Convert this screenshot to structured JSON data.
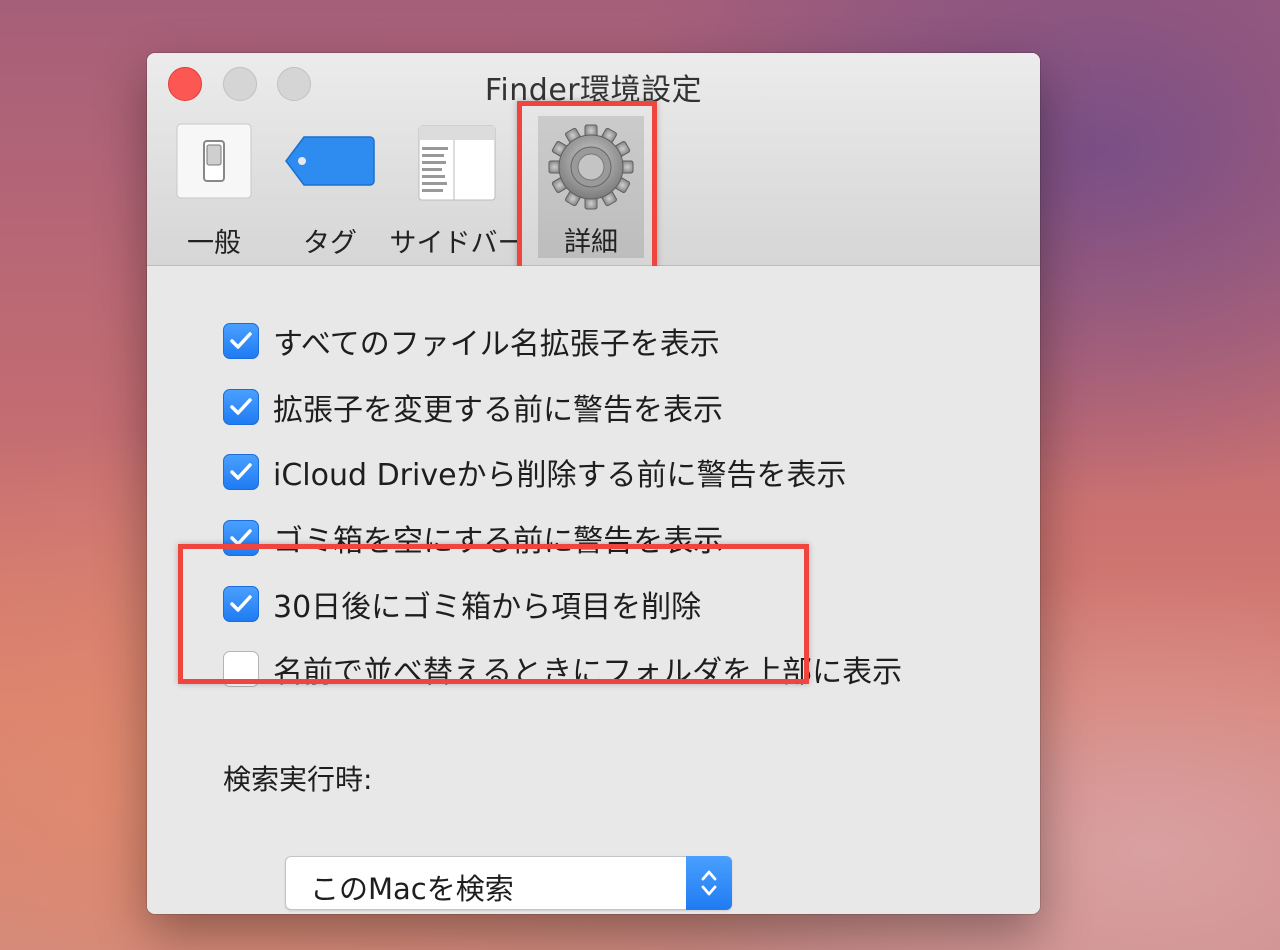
{
  "window": {
    "title": "Finder環境設定"
  },
  "toolbar": {
    "tabs": [
      {
        "label": "一般",
        "icon": "switch-icon"
      },
      {
        "label": "タグ",
        "icon": "tag-icon"
      },
      {
        "label": "サイドバー",
        "icon": "sidebar-icon"
      },
      {
        "label": "詳細",
        "icon": "gear-icon",
        "selected": true
      }
    ]
  },
  "options": [
    {
      "label": "すべてのファイル名拡張子を表示",
      "checked": true
    },
    {
      "label": "拡張子を変更する前に警告を表示",
      "checked": true
    },
    {
      "label": "iCloud Driveから削除する前に警告を表示",
      "checked": true
    },
    {
      "label": "ゴミ箱を空にする前に警告を表示",
      "checked": true
    },
    {
      "label": "30日後にゴミ箱から項目を削除",
      "checked": true
    },
    {
      "label": "名前で並べ替えるときにフォルダを上部に表示",
      "checked": false
    }
  ],
  "search": {
    "label": "検索実行時:",
    "selected": "このMacを検索"
  },
  "colors": {
    "accent": "#1f7bf2",
    "highlight": "#f0443f",
    "close": "#fc5753"
  }
}
